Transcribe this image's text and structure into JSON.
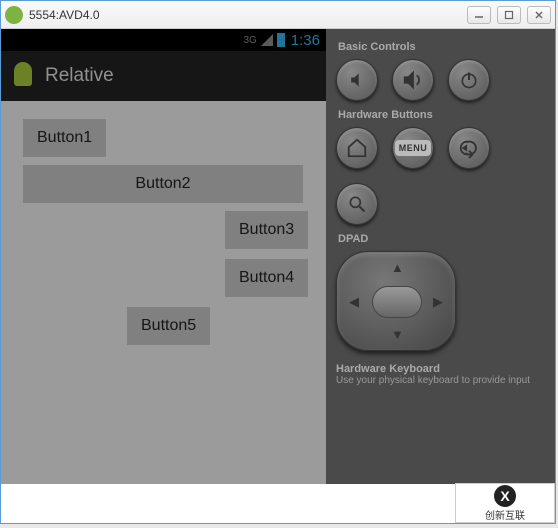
{
  "window": {
    "title": "5554:AVD4.0"
  },
  "status_bar": {
    "network_label": "3G",
    "time": "1:36"
  },
  "action_bar": {
    "title": "Relative"
  },
  "buttons": {
    "b1": "Button1",
    "b2": "Button2",
    "b3": "Button3",
    "b4": "Button4",
    "b5": "Button5"
  },
  "control_sections": {
    "basic": "Basic Controls",
    "hardware": "Hardware Buttons",
    "dpad": "DPAD",
    "menu_label": "MENU",
    "hk_title": "Hardware Keyboard",
    "hk_sub": "Use your physical keyboard to provide input"
  },
  "watermark": {
    "glyph": "X",
    "text": "创新互联"
  }
}
